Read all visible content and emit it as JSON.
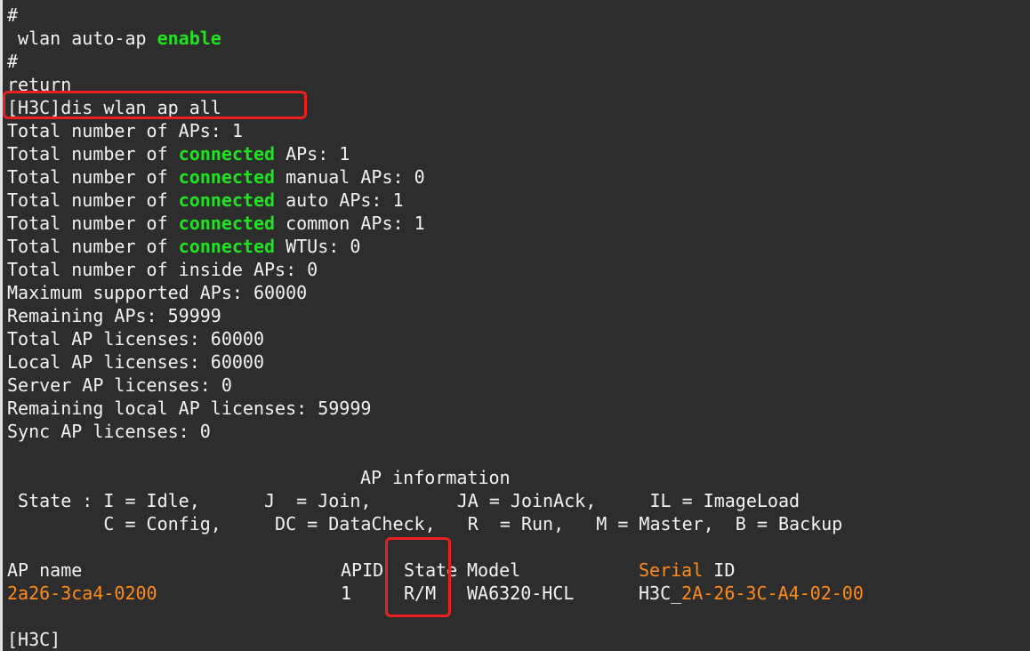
{
  "lines": [
    {
      "text": "#"
    },
    {
      "pre": " wlan auto-ap ",
      "hl": "enable"
    },
    {
      "text": "#"
    },
    {
      "text": "return"
    },
    {
      "text": "[H3C]dis wlan ap all"
    },
    {
      "text": "Total number of APs: 1"
    },
    {
      "pre": "Total number of ",
      "hl": "connected",
      "post": " APs: 1"
    },
    {
      "pre": "Total number of ",
      "hl": "connected",
      "post": " manual APs: 0"
    },
    {
      "pre": "Total number of ",
      "hl": "connected",
      "post": " auto APs: 1"
    },
    {
      "pre": "Total number of ",
      "hl": "connected",
      "post": " common APs: 1"
    },
    {
      "pre": "Total number of ",
      "hl": "connected",
      "post": " WTUs: 0"
    },
    {
      "text": "Total number of inside APs: 0"
    },
    {
      "text": "Maximum supported APs: 60000"
    },
    {
      "text": "Remaining APs: 59999"
    },
    {
      "text": "Total AP licenses: 60000"
    },
    {
      "text": "Local AP licenses: 60000"
    },
    {
      "text": "Server AP licenses: 0"
    },
    {
      "text": "Remaining local AP licenses: 59999"
    },
    {
      "text": "Sync AP licenses: 0"
    }
  ],
  "ap_info": {
    "title": "AP information",
    "legend_1": " State : I = Idle,      J  = Join,        JA = JoinAck,     IL = ImageLoad",
    "legend_2": "         C = Config,     DC = DataCheck,   R  = Run,   M = Master,  B = Backup"
  },
  "table": {
    "headers": {
      "ap_name": "AP name",
      "apid": "APID",
      "state": "State",
      "model": "Model",
      "serial_hl": "Serial",
      "serial_rest": " ID"
    },
    "row": {
      "ap_name": "2a26-3ca4-0200",
      "apid": "1",
      "state": "R/M",
      "model": "WA6320-HCL",
      "serial_prefix": "H3C_",
      "serial_hl": "2A-26-3C-A4-02-00"
    }
  },
  "prompt": "[H3C]",
  "colors": {
    "keyword_green": "#22e122",
    "value_orange": "#ff8c1a",
    "annotation_red": "#e82020",
    "background": "#2d2d2d",
    "text": "#f2f2f2"
  }
}
